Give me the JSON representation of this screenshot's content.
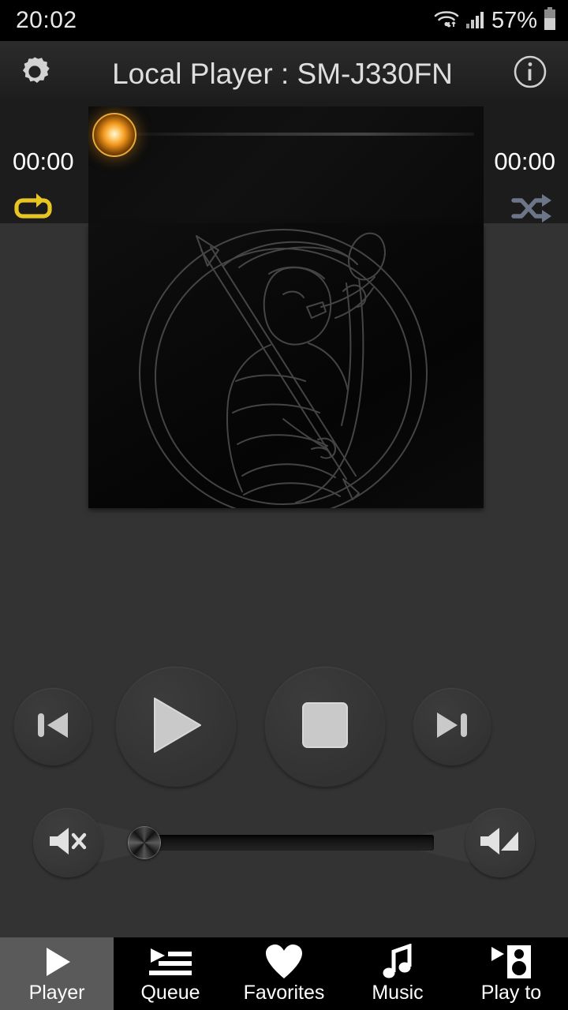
{
  "status_bar": {
    "time": "20:02",
    "battery_percent": "57%",
    "wifi_icon": "wifi-icon",
    "signal_icon": "signal-bars-icon",
    "battery_icon": "battery-icon"
  },
  "title_bar": {
    "settings_icon": "gear-icon",
    "title": "Local Player : SM-J330FN",
    "info_icon": "info-icon"
  },
  "seek_bar": {
    "elapsed": "00:00",
    "remaining": "00:00",
    "progress_percent": 0,
    "thumb_color": "#f3991f",
    "repeat_label": "repeat-icon",
    "repeat_color": "#e8c522",
    "repeat_active": true,
    "shuffle_label": "shuffle-icon",
    "shuffle_color": "#6d7689",
    "shuffle_active": false
  },
  "album_art": {
    "artwork_label": "default-album-artwork",
    "description": "Line-art emblem of a person blowing a horn inside a circle"
  },
  "transport": {
    "previous_label": "Previous",
    "play_label": "Play",
    "stop_label": "Stop",
    "next_label": "Next",
    "glyph_color": "#c9c9c9"
  },
  "volume": {
    "mute_label": "Mute",
    "volume_up_label": "Volume up",
    "level_percent": 0,
    "mute_icon": "speaker-mute-icon",
    "up_icon": "speaker-volume-icon"
  },
  "bottom_nav": {
    "active_index": 0,
    "items": [
      {
        "label": "Player",
        "icon": "play-triangle-icon"
      },
      {
        "label": "Queue",
        "icon": "playlist-icon"
      },
      {
        "label": "Favorites",
        "icon": "heart-icon"
      },
      {
        "label": "Music",
        "icon": "music-note-icon"
      },
      {
        "label": "Play to",
        "icon": "cast-speaker-icon"
      }
    ]
  }
}
